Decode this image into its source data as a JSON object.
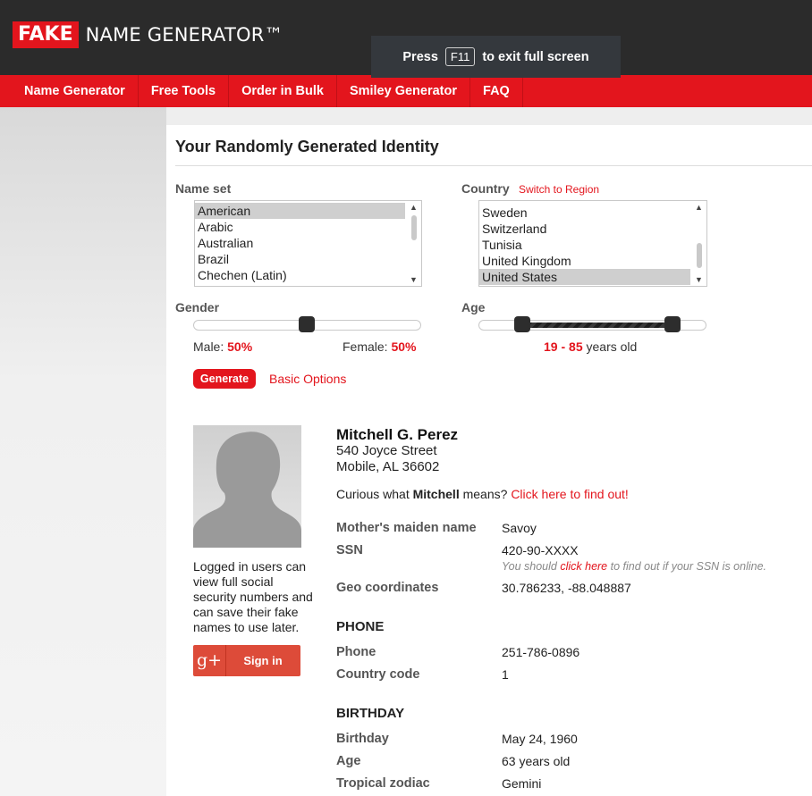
{
  "header": {
    "logo_fake": "FAKE",
    "logo_rest": "NAME GENERATOR™",
    "nav": [
      "Name Generator",
      "Free Tools",
      "Order in Bulk",
      "Smiley Generator",
      "FAQ"
    ]
  },
  "fullscreen_toast": {
    "press": "Press",
    "key": "F11",
    "rest": "to exit full screen"
  },
  "form": {
    "title": "Your Randomly Generated Identity",
    "nameset_label": "Name set",
    "nameset_options": [
      "American",
      "Arabic",
      "Australian",
      "Brazil",
      "Chechen (Latin)"
    ],
    "nameset_selected": "American",
    "country_label": "Country",
    "switch_region": "Switch to Region",
    "country_options": [
      "Sweden",
      "Switzerland",
      "Tunisia",
      "United Kingdom",
      "United States"
    ],
    "country_selected": "United States",
    "gender_label": "Gender",
    "gender_male_fraction": 0.5,
    "male_label": "Male:",
    "male_value": "50%",
    "female_label": "Female:",
    "female_value": "50%",
    "age_label": "Age",
    "age_min": "19",
    "age_sep": "-",
    "age_max": "85",
    "age_suffix": "years old",
    "generate_button": "Generate",
    "basic_options": "Basic Options"
  },
  "identity": {
    "name": "Mitchell G. Perez",
    "address_line1": "540 Joyce Street",
    "address_line2": "Mobile, AL 36602",
    "curious_prefix": "Curious what",
    "curious_name": "Mitchell",
    "curious_mid": "means?",
    "curious_link": "Click here to find out!",
    "note": "Logged in users can view full social security numbers and can save their fake names to use later.",
    "gplus_icon": "g+",
    "signin": "Sign in",
    "fields": {
      "maiden_label": "Mother's maiden name",
      "maiden_value": "Savoy",
      "ssn_label": "SSN",
      "ssn_value": "420-90-XXXX",
      "ssn_hint_pre": "You should",
      "ssn_hint_link": "click here",
      "ssn_hint_post": "to find out if your SSN is online.",
      "geo_label": "Geo coordinates",
      "geo_value": "30.786233, -88.048887"
    },
    "phone_section": "PHONE",
    "phone_label": "Phone",
    "phone_value": "251-786-0896",
    "cc_label": "Country code",
    "cc_value": "1",
    "birthday_section": "BIRTHDAY",
    "birthday_label": "Birthday",
    "birthday_value": "May 24, 1960",
    "age_label": "Age",
    "age_value": "63 years old",
    "zodiac_label": "Tropical zodiac",
    "zodiac_value": "Gemini"
  },
  "colors": {
    "brand_red": "#e3151d",
    "header_dark": "#2b2b2b"
  }
}
